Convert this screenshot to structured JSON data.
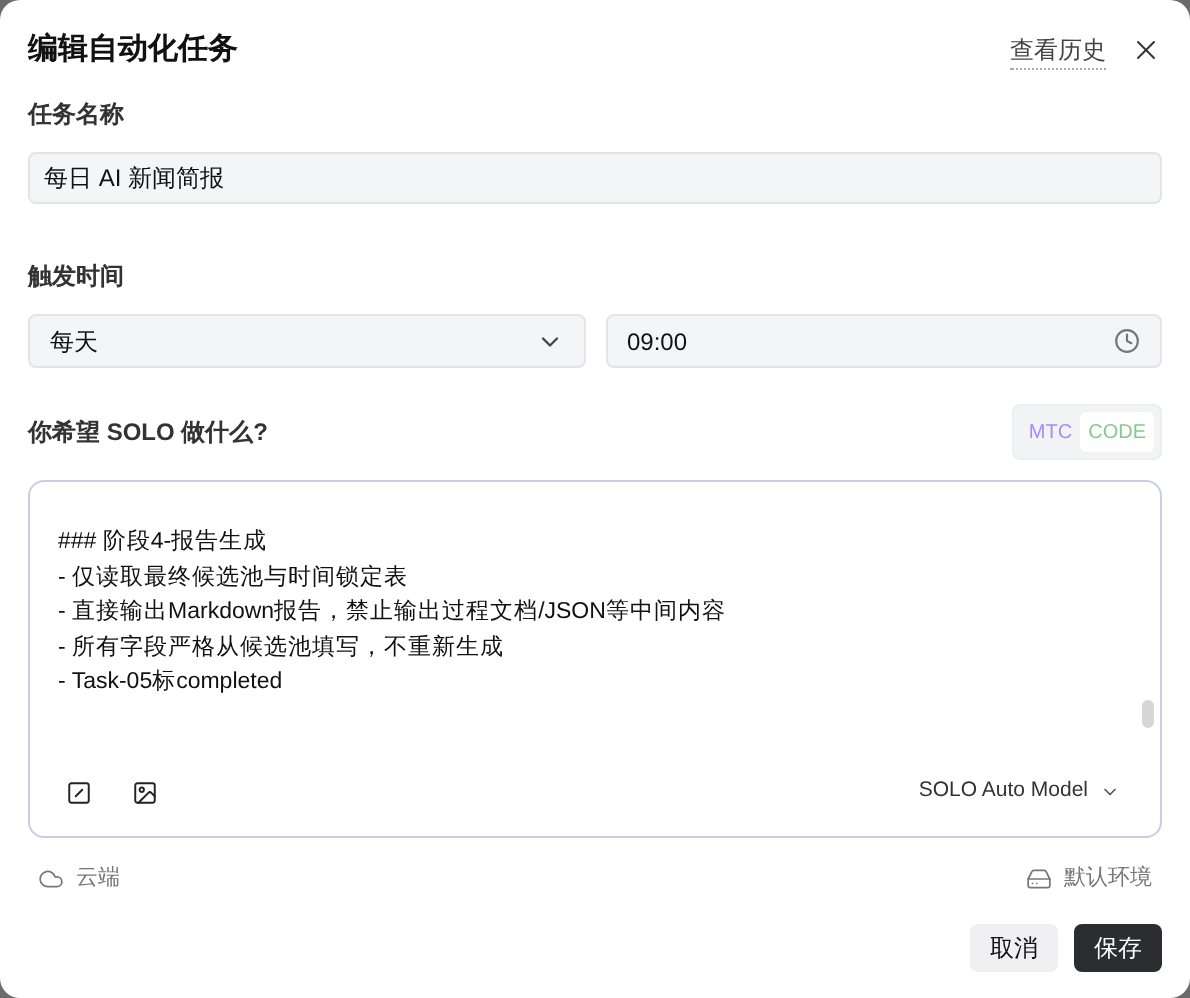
{
  "dialog": {
    "title": "编辑自动化任务",
    "history_link": "查看历史"
  },
  "task_name": {
    "label": "任务名称",
    "value": "每日 AI 新闻简报"
  },
  "trigger": {
    "label": "触发时间",
    "frequency": "每天",
    "time": "09:00"
  },
  "prompt": {
    "label": "你希望 SOLO 做什么?",
    "modes": [
      {
        "label": "MTC",
        "selected": false,
        "color": "#a78bfa"
      },
      {
        "label": "CODE",
        "selected": true,
        "color": "#86c98f"
      }
    ],
    "lines": [
      "### 阶段4-报告生成",
      "- 仅读取最终候选池与时间锁定表",
      "- 直接输出Markdown报告，禁止输出过程文档/JSON等中间内容",
      "- 所有字段严格从候选池填写，不重新生成",
      "- Task-05标completed"
    ],
    "model": "SOLO Auto Model"
  },
  "environment": {
    "location": "云端",
    "env": "默认环境"
  },
  "buttons": {
    "cancel": "取消",
    "save": "保存"
  }
}
